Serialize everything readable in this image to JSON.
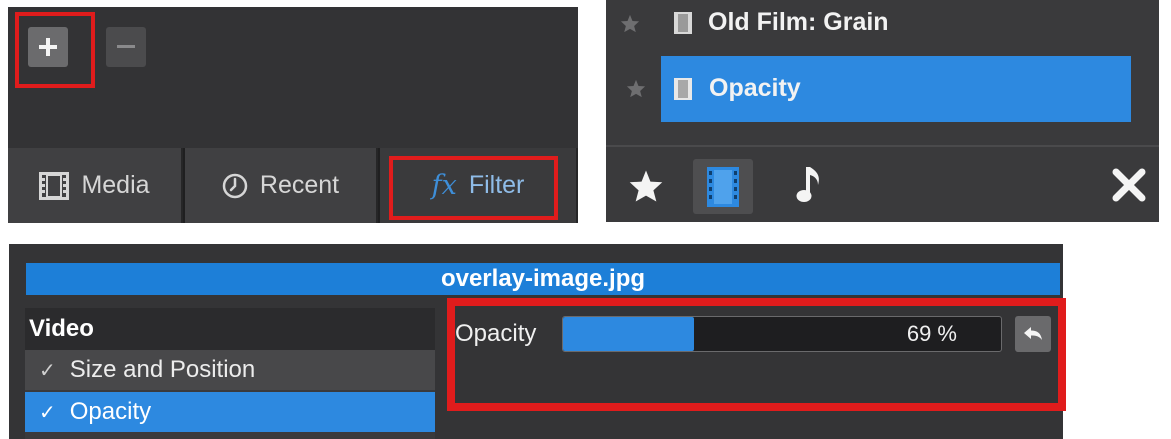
{
  "toolbar": {
    "add_icon": "plus-icon",
    "remove_icon": "minus-icon"
  },
  "tabs": [
    {
      "label": "Media",
      "icon": "film-icon"
    },
    {
      "label": "Recent",
      "icon": "clock-icon"
    },
    {
      "label": "Filter",
      "icon": "fx-icon",
      "icon_text": "fx"
    }
  ],
  "filter_list": {
    "items": [
      {
        "label": "Old Film: Grain",
        "selected": false
      },
      {
        "label": "Opacity",
        "selected": true
      }
    ],
    "bottom_bar": [
      "favorites-star-icon",
      "video-filters-icon",
      "audio-filters-icon",
      "close-icon"
    ]
  },
  "properties": {
    "clip_title": "overlay-image.jpg",
    "section_header": "Video",
    "attached_filters": [
      {
        "label": "Size and Position",
        "check": "✓"
      },
      {
        "label": "Opacity",
        "check": "✓"
      }
    ],
    "opacity_label": "Opacity",
    "opacity_value_text": "69 %",
    "opacity_fill_fraction": 0.3,
    "reset_icon": "undo-arrow-icon"
  },
  "colors": {
    "highlight": "#e01c1c",
    "accent": "#2d89e0",
    "panel": "#333335"
  }
}
